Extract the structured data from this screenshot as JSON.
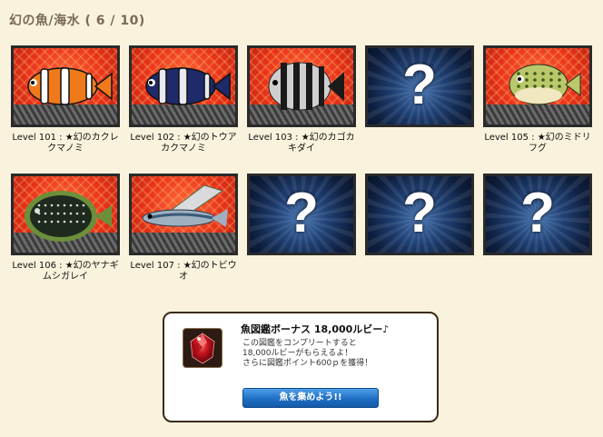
{
  "page": {
    "title": "幻の魚/海水 ( 6 / 10)"
  },
  "collection": [
    {
      "label": "Level 101 : ★幻のカクレクマノミ",
      "found": true,
      "icon": "clownfish-icon",
      "colors": {
        "body": "#f07a1a",
        "stripe": "#ffffff",
        "fin": "#2a2a2a"
      }
    },
    {
      "label": "Level 102 : ★幻のトウアカクマノミ",
      "found": true,
      "icon": "dark-clownfish-icon",
      "colors": {
        "body": "#1e2a6a",
        "stripe": "#e8e8f0",
        "fin": "#2a2a2a"
      }
    },
    {
      "label": "Level 103 : ★幻のカゴカキダイ",
      "found": true,
      "icon": "striped-fish-icon",
      "colors": {
        "body": "#cfcfcf",
        "stripe": "#1a1a1a",
        "fin": "#444444"
      }
    },
    {
      "label": "",
      "found": false,
      "icon": "question-mark-icon"
    },
    {
      "label": "Level 105 : ★幻のミドリフグ",
      "found": true,
      "icon": "pufferfish-icon",
      "colors": {
        "body": "#b9c86a",
        "stripe": "#3f5a1e",
        "fin": "#f1e7c0"
      }
    },
    {
      "label": "Level 106 : ★幻のヤナギムシガレイ",
      "found": true,
      "icon": "flatfish-icon",
      "colors": {
        "body": "#1f2a1f",
        "stripe": "#d8e0d0",
        "fin": "#6c8f3a"
      }
    },
    {
      "label": "Level 107 : ★幻のトビウオ",
      "found": true,
      "icon": "flying-fish-icon",
      "colors": {
        "body": "#9fb0c0",
        "stripe": "#3a5a7a",
        "fin": "#d8e8f0"
      }
    },
    {
      "label": "",
      "found": false,
      "icon": "question-mark-icon"
    },
    {
      "label": "",
      "found": false,
      "icon": "question-mark-icon"
    },
    {
      "label": "",
      "found": false,
      "icon": "question-mark-icon"
    }
  ],
  "unknown_mark": "?",
  "bonus": {
    "title": "魚図鑑ボーナス 18,000ルビー♪",
    "line1": "この図鑑をコンプリートすると",
    "line2": "18,000ルビーがもらえるよ！",
    "line3": "さらに図鑑ポイント600ｐを獲得！",
    "button_label": "魚を集めよう!!",
    "gem_icon": "ruby-gem-icon",
    "gem_color": "#c8141e"
  }
}
